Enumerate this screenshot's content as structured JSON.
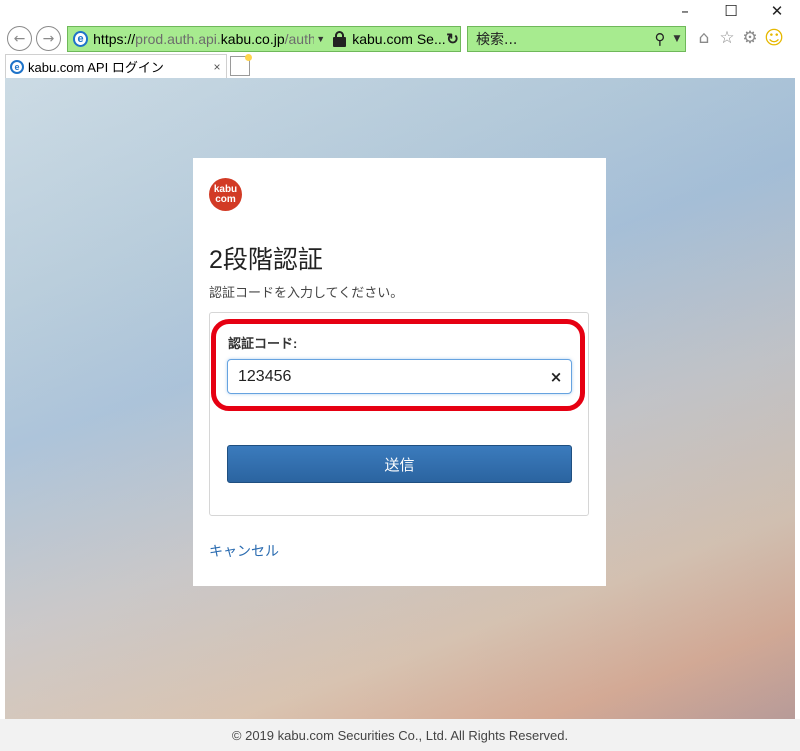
{
  "window": {
    "minimize": "–",
    "maximize": "☐",
    "close": "✕"
  },
  "nav": {
    "back": "←",
    "forward": "→",
    "url_prefix": "https://",
    "url_subdomain": "prod.auth.api.",
    "url_domain": "kabu.co.jp",
    "url_path": "/auth/",
    "site_name": "kabu.com Se...",
    "search_placeholder": "検索...",
    "ie_glyph": "e"
  },
  "tab": {
    "title": "kabu.com API ログイン",
    "close": "×"
  },
  "login": {
    "logo_line1": "kabu",
    "logo_line2": "com",
    "heading": "2段階認証",
    "subtext": "認証コードを入力してください。",
    "code_label": "認証コード:",
    "code_value": "123456",
    "clear": "×",
    "submit": "送信",
    "cancel": "キャンセル"
  },
  "footer": {
    "copyright": "© 2019 kabu.com Securities Co., Ltd. All Rights Reserved."
  },
  "colors": {
    "address_bar": "#a7eb8f",
    "logo": "#d23a25",
    "button": "#2b64a0",
    "link": "#2a6bb0",
    "highlight": "#e60012"
  },
  "icons": {
    "home": "home-icon",
    "favorites": "star-icon",
    "settings": "gear-icon",
    "feedback": "smiley-icon"
  }
}
